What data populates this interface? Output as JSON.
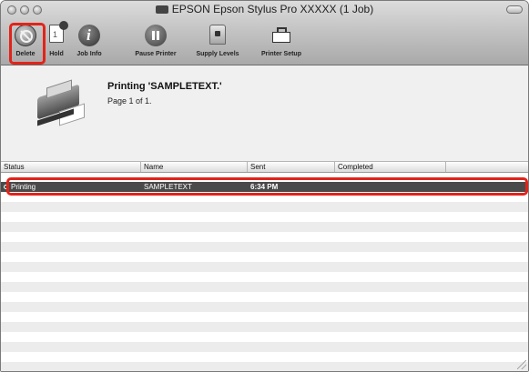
{
  "window": {
    "title": "EPSON Epson Stylus Pro XXXXX (1 Job)"
  },
  "toolbar": {
    "buttons": [
      {
        "label": "Delete",
        "icon": "delete-icon"
      },
      {
        "label": "Hold",
        "icon": "hold-icon"
      },
      {
        "label": "Job Info",
        "icon": "info-icon"
      },
      {
        "label": "Pause Printer",
        "icon": "pause-icon"
      },
      {
        "label": "Supply Levels",
        "icon": "supply-levels-icon"
      },
      {
        "label": "Printer Setup",
        "icon": "printer-setup-icon"
      }
    ]
  },
  "status": {
    "main": "Printing 'SAMPLETEXT.'",
    "sub": "Page 1 of 1."
  },
  "table": {
    "columns": [
      "Status",
      "Name",
      "Sent",
      "Completed"
    ],
    "rows": [
      {
        "status": "Printing",
        "name": "SAMPLETEXT",
        "sent": "6:34 PM",
        "completed": ""
      }
    ]
  },
  "colors": {
    "highlight": "#e2231a",
    "selected_row": "#4a4a4a"
  }
}
